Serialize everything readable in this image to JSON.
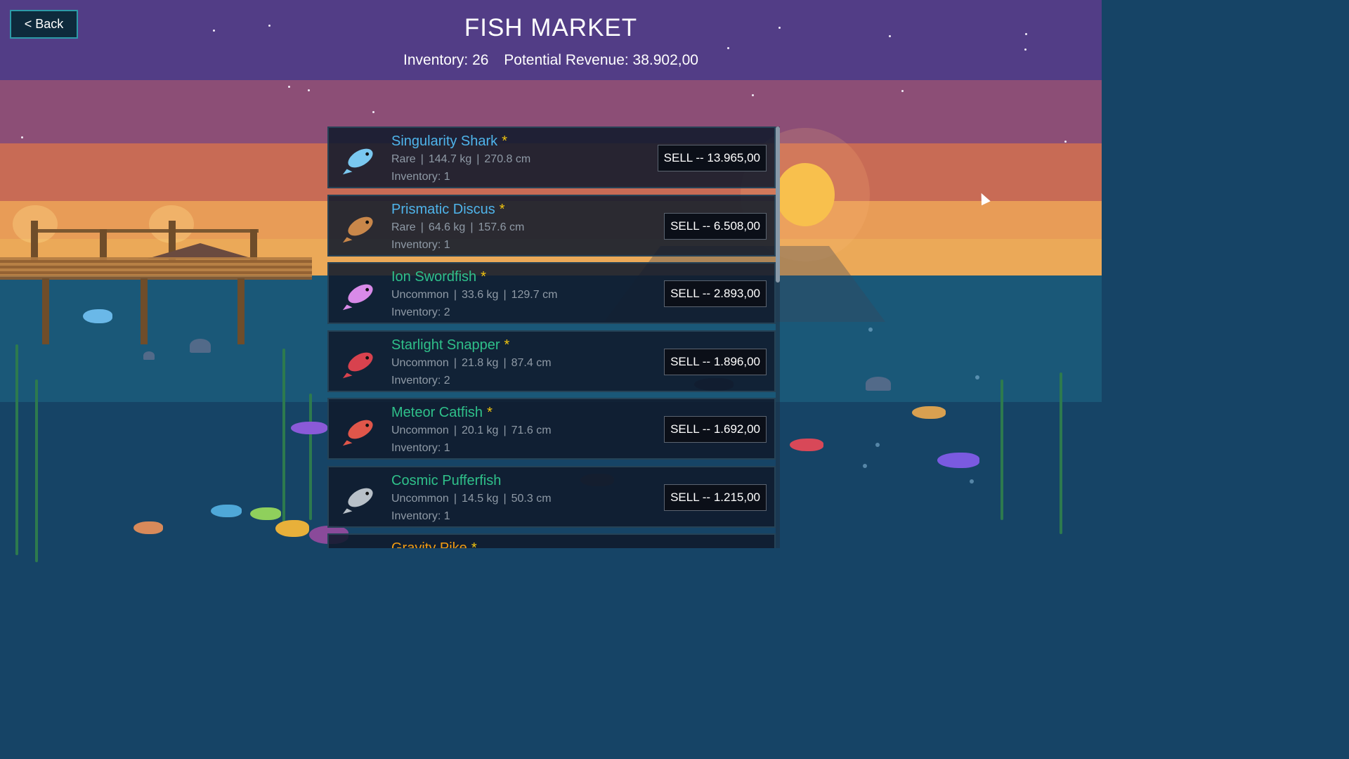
{
  "header": {
    "back_label": "< Back",
    "title": "FISH MARKET",
    "inventory_text": "Inventory: 26",
    "revenue_text": "Potential Revenue: 38.902,00"
  },
  "colors": {
    "rare": "#4fb4ea",
    "uncommon": "#2fc08a",
    "legendary": "#f39c12",
    "star": "#f1c40f"
  },
  "fish_list": [
    {
      "name": "Singularity Shark",
      "star": "*",
      "rarity": "Rare",
      "weight": "144.7 kg",
      "length": "270.8 cm",
      "inventory": "Inventory: 1",
      "sell": "SELL -- 13.965,00",
      "color": "#4fb4ea",
      "icon": "singularity-shark-icon"
    },
    {
      "name": "Prismatic Discus",
      "star": "*",
      "rarity": "Rare",
      "weight": "64.6 kg",
      "length": "157.6 cm",
      "inventory": "Inventory: 1",
      "sell": "SELL -- 6.508,00",
      "color": "#4fb4ea",
      "icon": "prismatic-discus-icon"
    },
    {
      "name": "Ion Swordfish",
      "star": "*",
      "rarity": "Uncommon",
      "weight": "33.6 kg",
      "length": "129.7 cm",
      "inventory": "Inventory: 2",
      "sell": "SELL -- 2.893,00",
      "color": "#2fc08a",
      "icon": "ion-swordfish-icon"
    },
    {
      "name": "Starlight Snapper",
      "star": "*",
      "rarity": "Uncommon",
      "weight": "21.8 kg",
      "length": "87.4 cm",
      "inventory": "Inventory: 2",
      "sell": "SELL -- 1.896,00",
      "color": "#2fc08a",
      "icon": "starlight-snapper-icon"
    },
    {
      "name": "Meteor Catfish",
      "star": "*",
      "rarity": "Uncommon",
      "weight": "20.1 kg",
      "length": "71.6 cm",
      "inventory": "Inventory: 1",
      "sell": "SELL -- 1.692,00",
      "color": "#2fc08a",
      "icon": "meteor-catfish-icon"
    },
    {
      "name": "Cosmic Pufferfish",
      "star": "",
      "rarity": "Uncommon",
      "weight": "14.5 kg",
      "length": "50.3 cm",
      "inventory": "Inventory: 1",
      "sell": "SELL -- 1.215,00",
      "color": "#2fc08a",
      "icon": "cosmic-pufferfish-icon"
    },
    {
      "name": "Gravity Pike",
      "star": "*",
      "rarity": "",
      "weight": "",
      "length": "",
      "inventory": "",
      "sell": "",
      "color": "#f39c12",
      "icon": "gravity-pike-icon"
    }
  ]
}
